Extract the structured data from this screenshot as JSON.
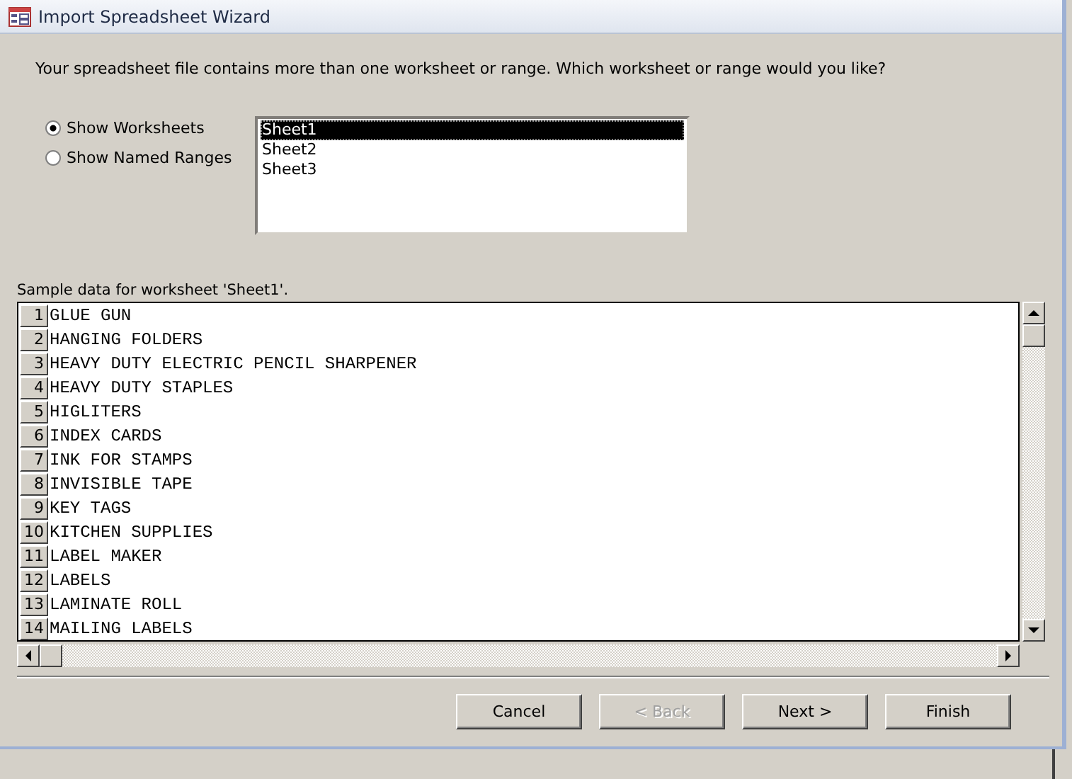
{
  "window": {
    "title": "Import Spreadsheet Wizard"
  },
  "prompt": "Your spreadsheet file contains more than one worksheet or range. Which worksheet or range would you like?",
  "options": [
    {
      "label": "Show Worksheets",
      "selected": true
    },
    {
      "label": "Show Named Ranges",
      "selected": false
    }
  ],
  "sheets": [
    {
      "label": "Sheet1",
      "selected": true
    },
    {
      "label": "Sheet2",
      "selected": false
    },
    {
      "label": "Sheet3",
      "selected": false
    }
  ],
  "sample": {
    "caption": "Sample data for worksheet 'Sheet1'.",
    "rows": [
      {
        "number": "1",
        "value": "GLUE GUN"
      },
      {
        "number": "2",
        "value": "HANGING FOLDERS"
      },
      {
        "number": "3",
        "value": "HEAVY DUTY ELECTRIC PENCIL SHARPENER"
      },
      {
        "number": "4",
        "value": "HEAVY DUTY STAPLES"
      },
      {
        "number": "5",
        "value": "HIGLITERS"
      },
      {
        "number": "6",
        "value": "INDEX CARDS"
      },
      {
        "number": "7",
        "value": "INK FOR STAMPS"
      },
      {
        "number": "8",
        "value": "INVISIBLE TAPE"
      },
      {
        "number": "9",
        "value": "KEY TAGS"
      },
      {
        "number": "10",
        "value": "KITCHEN SUPPLIES"
      },
      {
        "number": "11",
        "value": "LABEL MAKER"
      },
      {
        "number": "12",
        "value": "LABELS"
      },
      {
        "number": "13",
        "value": "LAMINATE ROLL"
      },
      {
        "number": "14",
        "value": "MAILING LABELS"
      }
    ]
  },
  "buttons": [
    {
      "label": "Cancel",
      "disabled": false
    },
    {
      "label": "< Back",
      "disabled": true
    },
    {
      "label": "Next >",
      "disabled": false
    },
    {
      "label": "Finish",
      "disabled": false
    }
  ]
}
